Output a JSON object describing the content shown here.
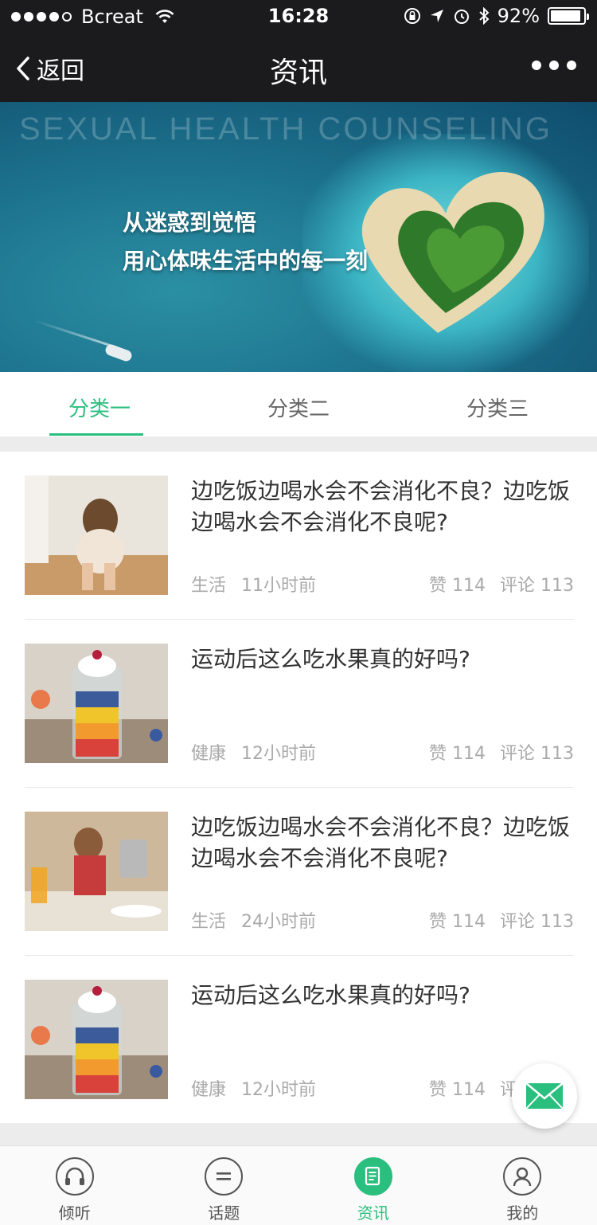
{
  "status_bar": {
    "carrier": "Bcreat",
    "time": "16:28",
    "battery": "92%",
    "battery_level": 0.92
  },
  "nav": {
    "back_label": "返回",
    "title": "资讯"
  },
  "banner": {
    "heading": "SEXUAL HEALTH COUNSELING",
    "line1": "从迷惑到觉悟",
    "line2": "用心体味生活中的每一刻"
  },
  "tabs": [
    {
      "label": "分类一",
      "active": true
    },
    {
      "label": "分类二",
      "active": false
    },
    {
      "label": "分类三",
      "active": false
    }
  ],
  "articles": [
    {
      "title": "边吃饭边喝水会不会消化不良？边吃饭边喝水会不会消化不良呢?",
      "category": "生活",
      "time": "11小时前",
      "likes": "赞 114",
      "comments": "评论 113",
      "image": "woman-sitting-floor"
    },
    {
      "title": "运动后这么吃水果真的好吗?",
      "category": "健康",
      "time": "12小时前",
      "likes": "赞 114",
      "comments": "评论 113",
      "image": "fruit-jar"
    },
    {
      "title": "边吃饭边喝水会不会消化不良？边吃饭边喝水会不会消化不良呢?",
      "category": "生活",
      "time": "24小时前",
      "likes": "赞 114",
      "comments": "评论 113",
      "image": "woman-pouring-drink"
    },
    {
      "title": "运动后这么吃水果真的好吗?",
      "category": "健康",
      "time": "12小时前",
      "likes": "赞 114",
      "comments": "评论 113",
      "image": "fruit-jar"
    }
  ],
  "tabbar": [
    {
      "label": "倾听",
      "icon": "headphones-icon",
      "active": false
    },
    {
      "label": "话题",
      "icon": "chat-bubble-icon",
      "active": false
    },
    {
      "label": "资讯",
      "icon": "news-icon",
      "active": true
    },
    {
      "label": "我的",
      "icon": "person-icon",
      "active": false
    }
  ],
  "colors": {
    "accent": "#2bbf7f",
    "header_bg": "#1b1b1e"
  }
}
